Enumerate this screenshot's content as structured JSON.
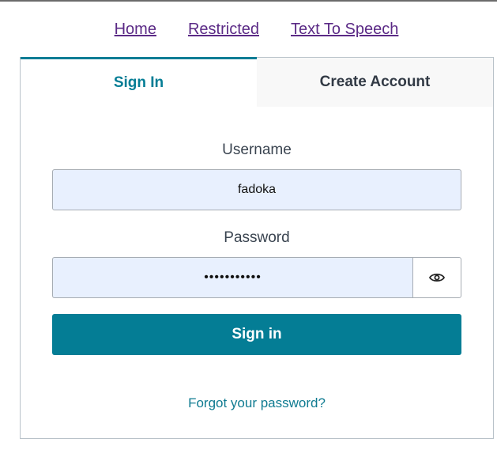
{
  "nav": {
    "links": [
      "Home",
      "Restricted",
      "Text To Speech"
    ]
  },
  "tabs": {
    "signin_label": "Sign In",
    "create_label": "Create Account",
    "active": "Sign In"
  },
  "form": {
    "username_label": "Username",
    "username_value": "fadoka",
    "password_label": "Password",
    "password_masked": "•••••••••••",
    "password_toggle_icon": "eye-icon",
    "submit_label": "Sign in",
    "forgot_label": "Forgot your password?"
  },
  "colors": {
    "accent": "#047d95",
    "link": "#5b2a86",
    "input_bg": "#e8f0fe"
  }
}
